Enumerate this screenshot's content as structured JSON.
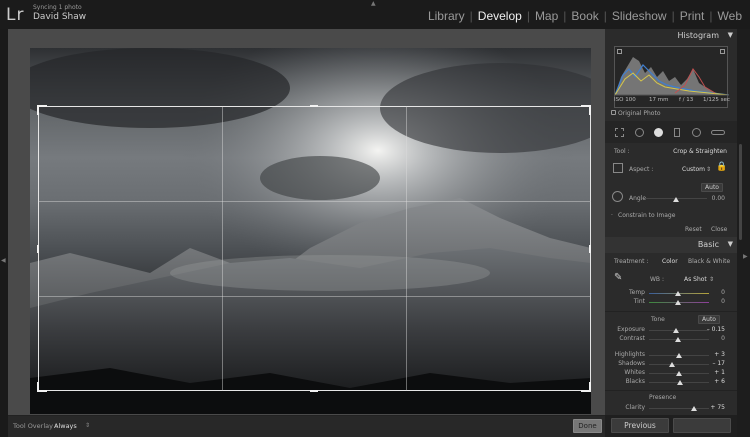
{
  "app": {
    "logo": "Lr",
    "status": "Syncing 1 photo",
    "user": "David Shaw"
  },
  "modules": [
    {
      "label": "Library",
      "active": false
    },
    {
      "label": "Develop",
      "active": true
    },
    {
      "label": "Map",
      "active": false
    },
    {
      "label": "Book",
      "active": false
    },
    {
      "label": "Slideshow",
      "active": false
    },
    {
      "label": "Print",
      "active": false
    },
    {
      "label": "Web",
      "active": false
    }
  ],
  "toolbar": {
    "overlay_label": "Tool Overlay :",
    "overlay_value": "Always",
    "done_label": "Done"
  },
  "histogram": {
    "title": "Histogram",
    "iso": "ISO 100",
    "focal": "17 mm",
    "aperture": "f / 13",
    "shutter": "1/125 sec",
    "original_photo": "Original Photo"
  },
  "crop": {
    "tool_label": "Tool :",
    "tool_name": "Crop & Straighten",
    "aspect_label": "Aspect :",
    "aspect_value": "Custom",
    "auto_label": "Auto",
    "angle_label": "Angle",
    "angle_value": "0.00",
    "constrain_label": "Constrain to Image",
    "reset_label": "Reset",
    "close_label": "Close"
  },
  "basic": {
    "title": "Basic",
    "treatment_label": "Treatment :",
    "color_label": "Color",
    "bw_label": "Black & White",
    "wb_label": "WB :",
    "wb_value": "As Shot",
    "temp_label": "Temp",
    "temp_value": "0",
    "tint_label": "Tint",
    "tint_value": "0",
    "tone_label": "Tone",
    "tone_auto": "Auto",
    "exposure_label": "Exposure",
    "exposure_value": "– 0.15",
    "contrast_label": "Contrast",
    "contrast_value": "0",
    "highlights_label": "Highlights",
    "highlights_value": "+ 3",
    "shadows_label": "Shadows",
    "shadows_value": "– 17",
    "whites_label": "Whites",
    "whites_value": "+ 1",
    "blacks_label": "Blacks",
    "blacks_value": "+ 6",
    "presence_label": "Presence",
    "clarity_label": "Clarity",
    "clarity_value": "+ 75"
  },
  "footer": {
    "previous_label": "Previous"
  },
  "colors": {
    "accent": "#f0f0f0",
    "panel": "#2b2b2b",
    "canvas": "#4a4a4a"
  }
}
